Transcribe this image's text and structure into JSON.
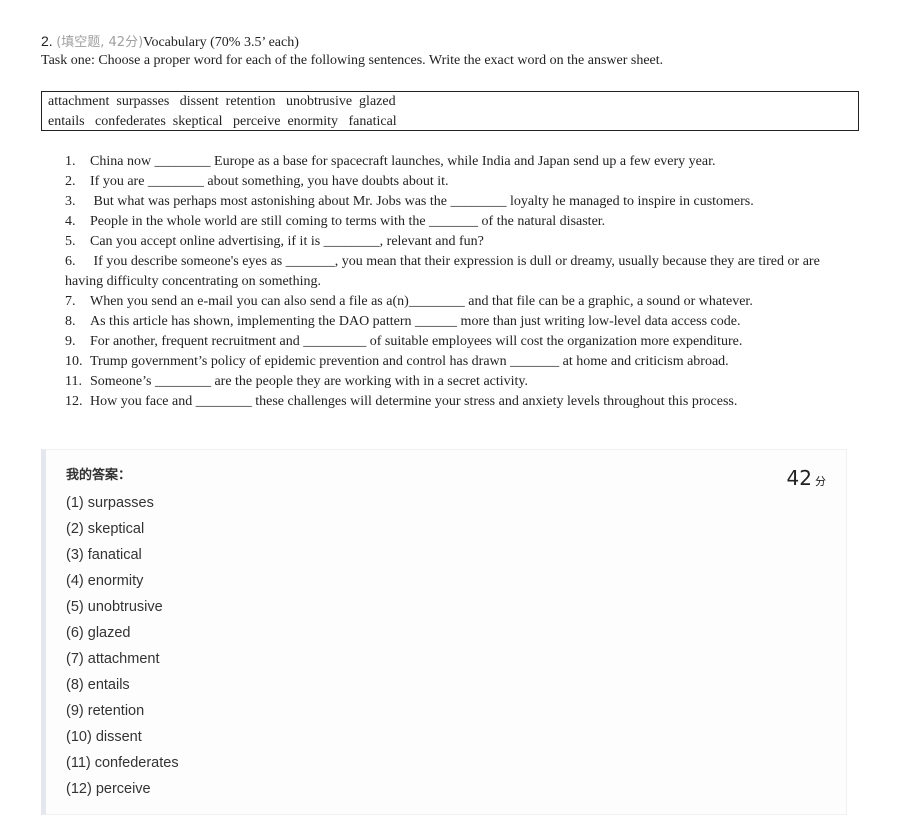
{
  "question": {
    "number": "2.",
    "type": "(填空题, 42分)",
    "title": "Vocabulary (70% 3.5’ each)",
    "instruction": "Task one: Choose a proper word for each of the following sentences. Write the exact word on the answer sheet."
  },
  "word_bank": {
    "row1": "attachment  surpasses   dissent  retention   unobtrusive  glazed",
    "row2": "entails   confederates  skeptical   perceive  enormity   fanatical"
  },
  "sentences": [
    {
      "num": "1.",
      "text": "China now ________ Europe as a base for spacecraft launches, while India and Japan send up a few every year."
    },
    {
      "num": "2.",
      "text": "If you are ________ about something, you have doubts about it."
    },
    {
      "num": "3.",
      "text": " But what was perhaps most astonishing about Mr. Jobs was the ________ loyalty he managed to inspire in customers."
    },
    {
      "num": "4.",
      "text": "People in the whole world are still coming to terms with the _______ of the natural disaster."
    },
    {
      "num": "5.",
      "text": "Can you accept online advertising, if it is ________, relevant and fun?"
    },
    {
      "num": "6.",
      "text": " If you describe someone's eyes as _______, you mean that their expression is dull or dreamy, usually because they are tired or are",
      "continuation": "having difficulty concentrating on something."
    },
    {
      "num": "7.",
      "text": "When you send an e-mail you can also send a file as a(n)________ and that file can be a graphic, a sound or whatever."
    },
    {
      "num": "8.",
      "text": "As this article has shown, implementing the DAO pattern ______ more than just writing low-level data access code."
    },
    {
      "num": "9.",
      "text": "For another, frequent recruitment and _________ of suitable employees will cost the organization more expenditure."
    },
    {
      "num": "10.",
      "text": "Trump government’s policy of epidemic prevention and control has drawn _______ at home and criticism abroad."
    },
    {
      "num": "11.",
      "text": "Someone’s ________ are the people they are working with in a secret activity."
    },
    {
      "num": "12.",
      "text": "How you face and ________ these challenges will determine your stress and anxiety levels throughout this process."
    }
  ],
  "answer_sheet": {
    "label": "我的答案：",
    "score_value": "42",
    "score_unit": "分",
    "answers": [
      "(1) surpasses",
      "(2) skeptical",
      "(3) fanatical",
      "(4) enormity",
      "(5) unobtrusive",
      "(6) glazed",
      "(7) attachment",
      "(8) entails",
      "(9) retention",
      "(10) dissent",
      "(11) confederates",
      "(12) perceive"
    ]
  }
}
